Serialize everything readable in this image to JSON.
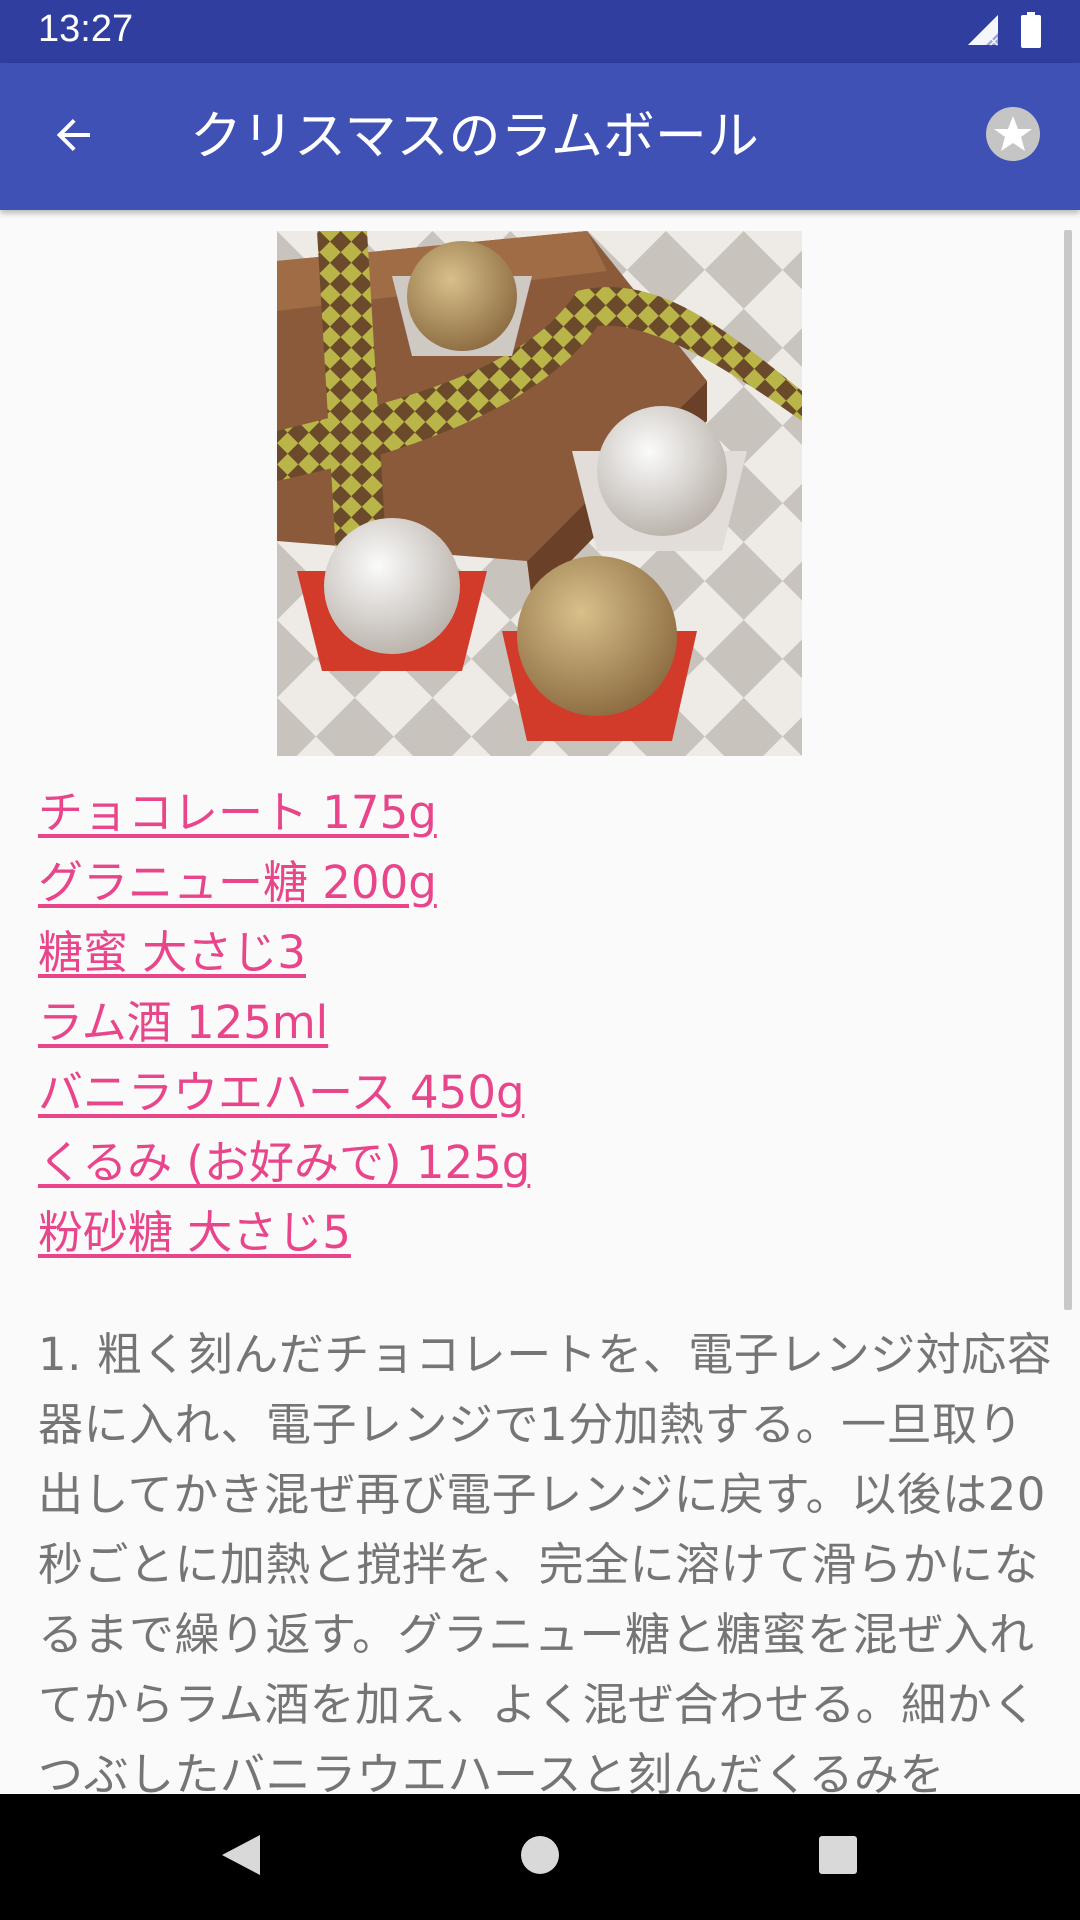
{
  "status_bar": {
    "time": "13:27",
    "icons": [
      "signal-no-data-icon",
      "battery-icon"
    ]
  },
  "app_bar": {
    "title": "クリスマスのラムボール",
    "back_icon": "arrow-back-icon",
    "favorite_icon": "star-circle-icon"
  },
  "photo": {
    "description_icon": "rum-ball-photo"
  },
  "ingredients": [
    "チョコレート 175g",
    "グラニュー糖 200g",
    "糖蜜 大さじ3",
    "ラム酒 125ml",
    "バニラウエハース 450g",
    "くるみ (お好みで) 125g",
    "粉砂糖 大さじ5"
  ],
  "instructions": "1. 粗く刻んだチョコレートを、電子レンジ対応容器に入れ、電子レンジで1分加熱する。一旦取り出してかき混ぜ再び電子レンジに戻す。以後は20秒ごとに加熱と撹拌を、完全に溶けて滑らかになるまで繰り返す。グラニュー糖と糖蜜を混ぜ入れてからラム酒を加え、よく混ぜ合わせる。細かくつぶしたバニラウエハースと刻んだくるみを",
  "nav_bar": {
    "back": "nav-back-icon",
    "home": "nav-home-icon",
    "recents": "nav-recents-icon"
  },
  "colors": {
    "status_bar": "#303f9f",
    "app_bar": "#3f51b5",
    "link": "#e8458b",
    "body_text": "#757575"
  }
}
